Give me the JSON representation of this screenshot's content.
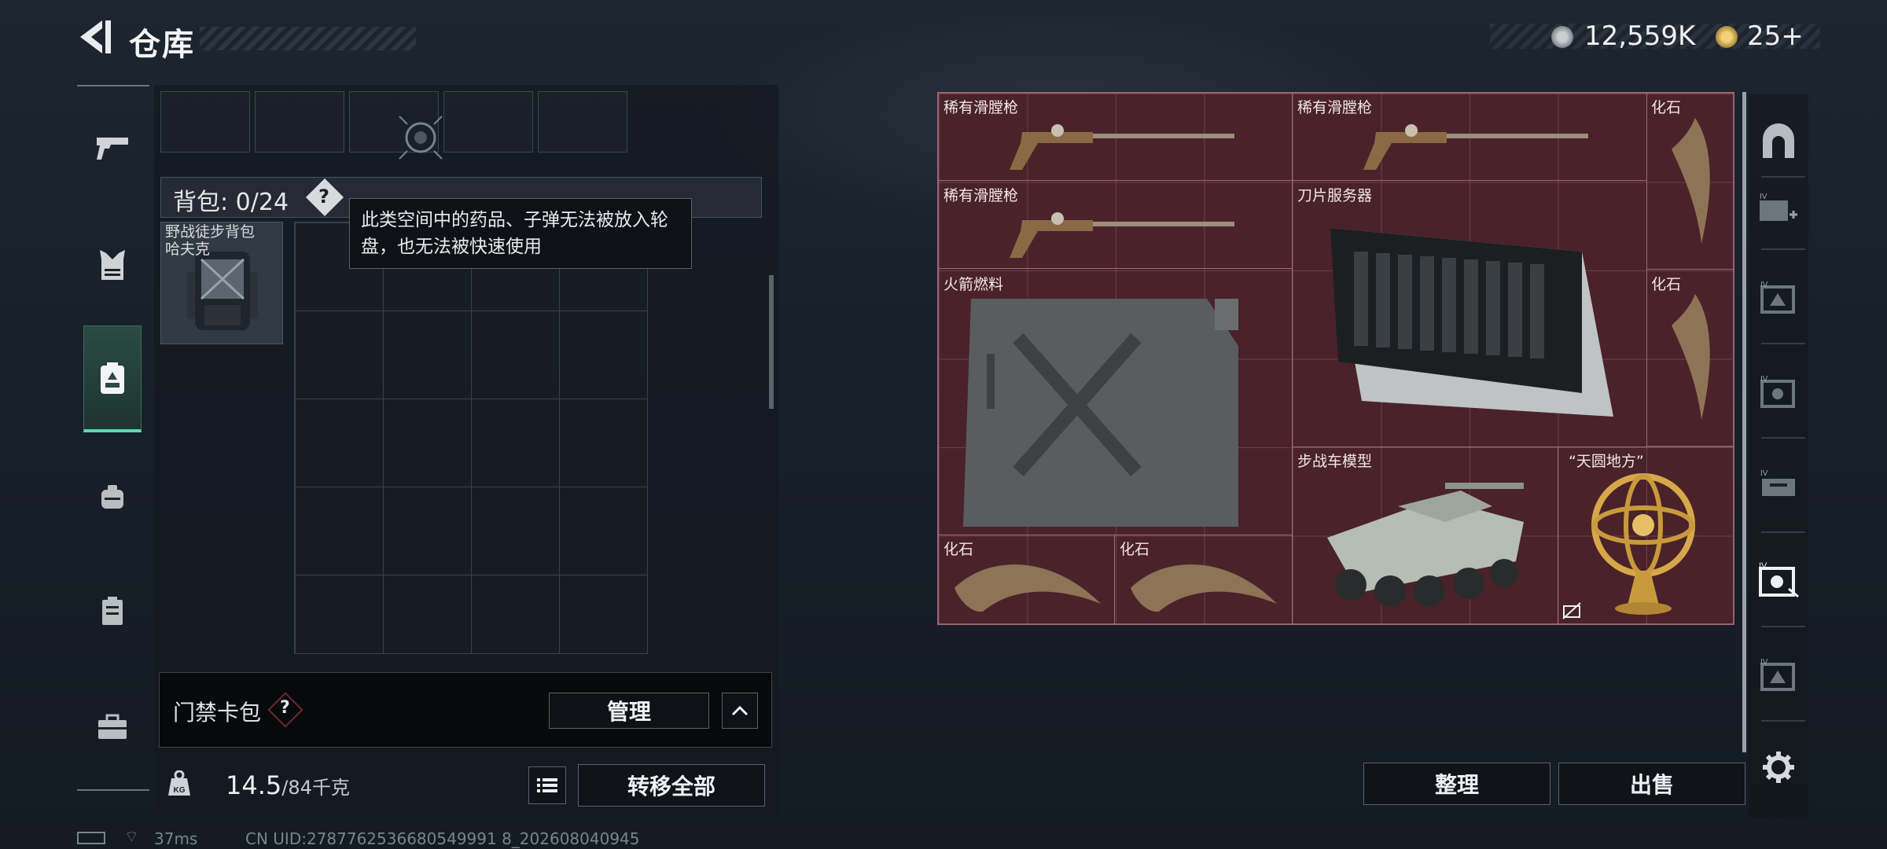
{
  "header": {
    "title": "仓库"
  },
  "currency": {
    "silver": "12,559K",
    "gold": "25+"
  },
  "sidebar": {
    "items": [
      "pistol-icon",
      "armor-icon",
      "backpack-tab-icon",
      "helmet-pack-icon",
      "case-icon",
      "toolbox-icon"
    ]
  },
  "backpack": {
    "label": "背包:",
    "count": "0/24",
    "item_name": "野战徒步背包",
    "item_name2": "哈夫克",
    "tooltip": "此类空间中的药品、子弹无法被放入轮盘，也无法被快速使用"
  },
  "access_card": {
    "label": "门禁卡包",
    "manage": "管理"
  },
  "weight": {
    "value": "14.5",
    "max": "/84千克",
    "transfer_all": "转移全部"
  },
  "stash": {
    "items": [
      {
        "label": "稀有滑膛枪"
      },
      {
        "label": "稀有滑膛枪"
      },
      {
        "label": "化石"
      },
      {
        "label": "稀有滑膛枪"
      },
      {
        "label": "刀片服务器"
      },
      {
        "label": "火箭燃料"
      },
      {
        "label": "化石"
      },
      {
        "label": "步战车模型"
      },
      {
        "label": "“天圆地方”"
      },
      {
        "label": "化石"
      },
      {
        "label": "化石"
      }
    ],
    "sort": "整理",
    "sell": "出售"
  },
  "status_bar": {
    "ping": "37ms",
    "uid": "CN UID:2787762536680549991 8_202608040945"
  },
  "colors": {
    "accent": "#5fd8b2",
    "stash_bg": "#4a2229"
  }
}
